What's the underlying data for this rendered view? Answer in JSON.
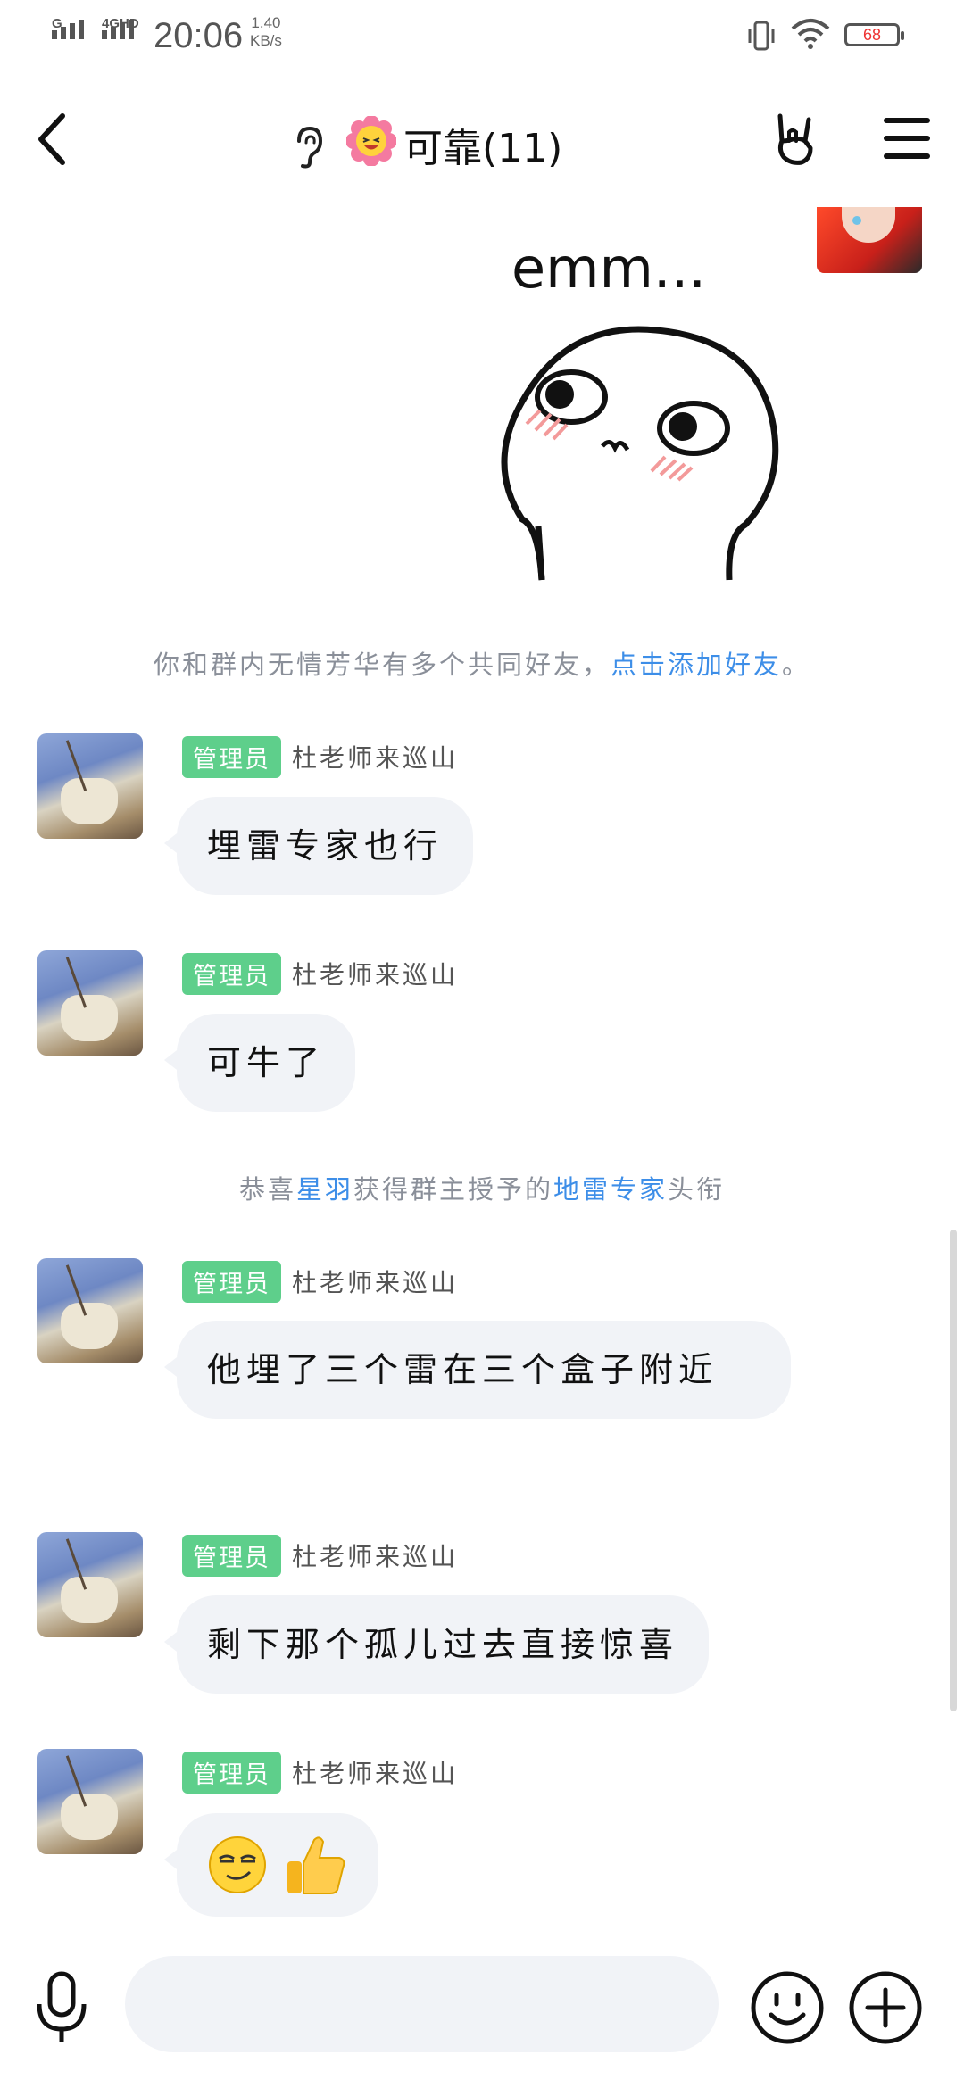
{
  "status_bar": {
    "sim1": "G",
    "sim2": "4GHD",
    "time": "20:06",
    "speed_value": "1.40",
    "speed_unit": "KB/s",
    "battery": "68"
  },
  "header": {
    "title": "可靠(11)",
    "icons": [
      "back-arrow-icon",
      "ear-icon",
      "flower-emoji-icon",
      "rock-hand-icon",
      "menu-icon"
    ]
  },
  "sticker": {
    "text": "emm..."
  },
  "system_notices": [
    {
      "prefix": "你和群内无情芳华有多个共同好友，",
      "link": "点击添加好友",
      "suffix": "。"
    },
    {
      "p1": "恭喜",
      "name": "星羽",
      "p2": "获得群主授予的",
      "title": "地雷专家",
      "p3": "头衔"
    }
  ],
  "messages": [
    {
      "badge": "管理员",
      "sender": "杜老师来巡山",
      "text": "埋雷专家也行"
    },
    {
      "badge": "管理员",
      "sender": "杜老师来巡山",
      "text": "可牛了"
    },
    {
      "badge": "管理员",
      "sender": "杜老师来巡山",
      "text": "他埋了三个雷在三个盒子附近"
    },
    {
      "badge": "管理员",
      "sender": "杜老师来巡山",
      "text": "剩下那个孤儿过去直接惊喜"
    },
    {
      "badge": "管理员",
      "sender": "杜老师来巡山",
      "emojis": [
        "smirk-emoji",
        "thumbs-up-emoji"
      ]
    }
  ],
  "input": {
    "placeholder": "",
    "icons": [
      "microphone-icon",
      "smile-icon",
      "plus-icon"
    ]
  },
  "colors": {
    "admin_badge": "#5ecf8b",
    "link": "#3d8ee8",
    "bubble": "#f1f3f7"
  }
}
